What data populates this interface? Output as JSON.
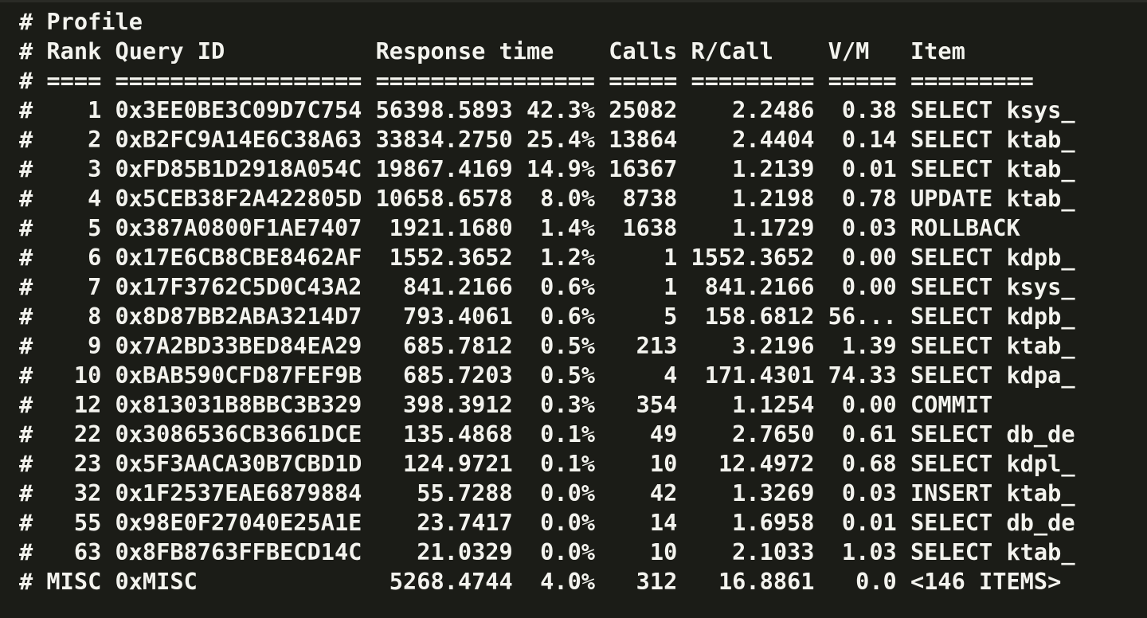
{
  "terminal": {
    "lines": [
      "# Profile",
      "# Rank Query ID           Response time    Calls R/Call    V/M   Item",
      "# ==== ================== ================ ===== ========= ===== =========",
      "#    1 0x3EE0BE3C09D7C754 56398.5893 42.3% 25082    2.2486  0.38 SELECT ksys_",
      "#    2 0xB2FC9A14E6C38A63 33834.2750 25.4% 13864    2.4404  0.14 SELECT ktab_",
      "#    3 0xFD85B1D2918A054C 19867.4169 14.9% 16367    1.2139  0.01 SELECT ktab_",
      "#    4 0x5CEB38F2A422805D 10658.6578  8.0%  8738    1.2198  0.78 UPDATE ktab_",
      "#    5 0x387A0800F1AE7407  1921.1680  1.4%  1638    1.1729  0.03 ROLLBACK",
      "#    6 0x17E6CB8CBE8462AF  1552.3652  1.2%     1 1552.3652  0.00 SELECT kdpb_",
      "#    7 0x17F3762C5D0C43A2   841.2166  0.6%     1  841.2166  0.00 SELECT ksys_",
      "#    8 0x8D87BB2ABA3214D7   793.4061  0.6%     5  158.6812 56... SELECT kdpb_",
      "#    9 0x7A2BD33BED84EA29   685.7812  0.5%   213    3.2196  1.39 SELECT ktab_",
      "#   10 0xBAB590CFD87FEF9B   685.7203  0.5%     4  171.4301 74.33 SELECT kdpa_",
      "#   12 0x813031B8BBC3B329   398.3912  0.3%   354    1.1254  0.00 COMMIT",
      "#   22 0x3086536CB3661DCE   135.4868  0.1%    49    2.7650  0.61 SELECT db_de",
      "#   23 0x5F3AACA30B7CBD1D   124.9721  0.1%    10   12.4972  0.68 SELECT kdpl_",
      "#   32 0x1F2537EAE6879884    55.7288  0.0%    42    1.3269  0.03 INSERT ktab_",
      "#   55 0x98E0F27040E25A1E    23.7417  0.0%    14    1.6958  0.01 SELECT db_de",
      "#   63 0x8FB8763FFBECD14C    21.0329  0.0%    10    2.1033  1.03 SELECT ktab_",
      "# MISC 0xMISC              5268.4744  4.0%   312   16.8861   0.0 <146 ITEMS>"
    ]
  }
}
